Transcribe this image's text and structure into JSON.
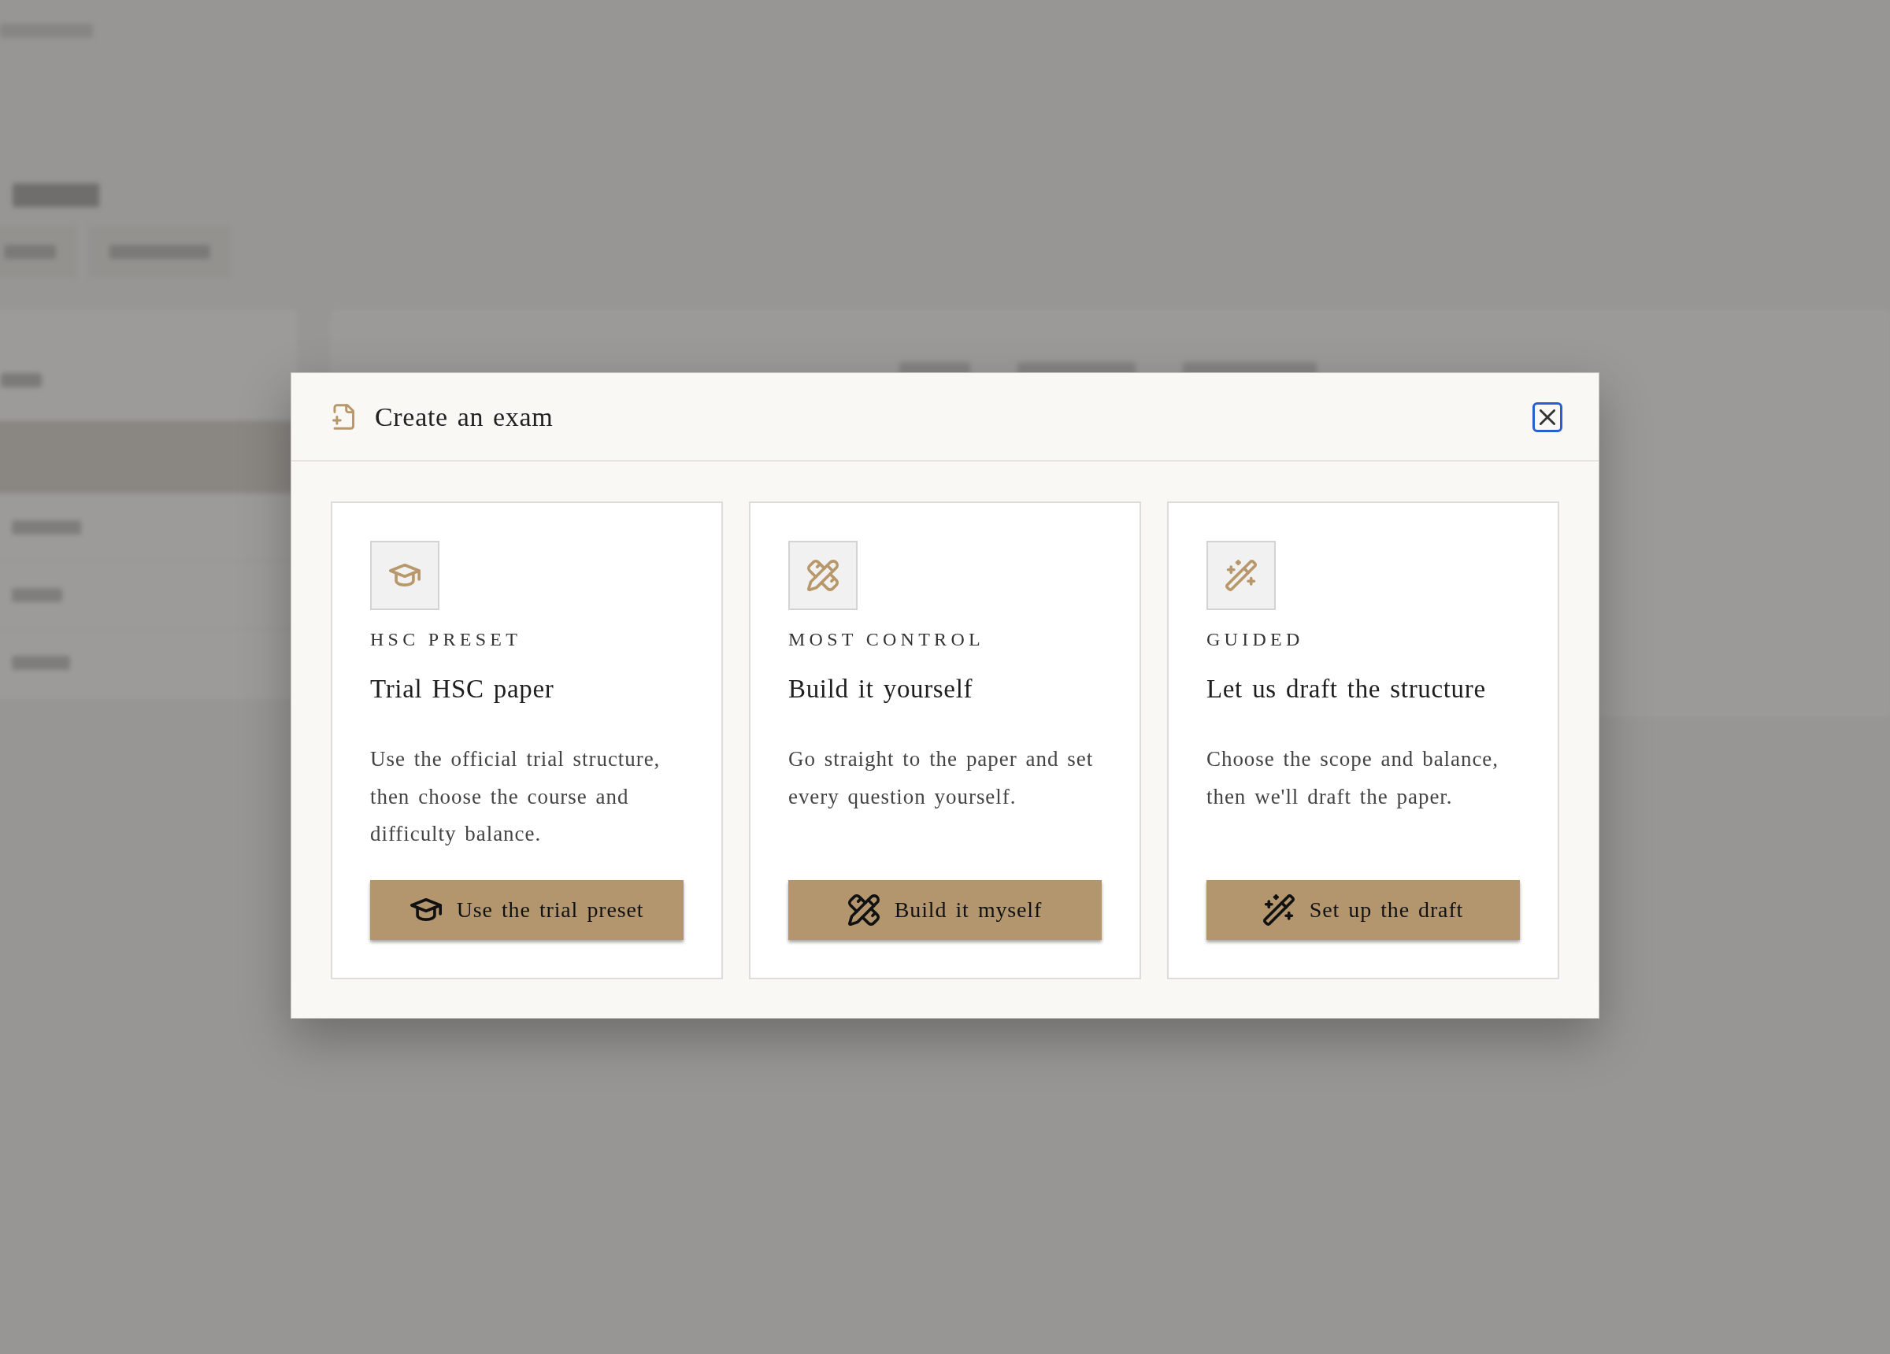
{
  "dialog": {
    "title": "Create an exam",
    "close_button": {
      "focused": true
    },
    "options": [
      {
        "kind": "preset",
        "eyebrow": "HSC PRESET",
        "title": "Trial HSC paper",
        "description": "Use the official trial structure, then choose the course and difficulty balance.",
        "button": "Use the trial preset"
      },
      {
        "kind": "manual",
        "eyebrow": "MOST CONTROL",
        "title": "Build it yourself",
        "description": "Go straight to the paper and set every question yourself.",
        "button": "Build it myself"
      },
      {
        "kind": "guided",
        "eyebrow": "GUIDED",
        "title": "Let us draft the structure",
        "description": "Choose the scope and balance, then we'll draft the paper.",
        "button": "Set up the draft"
      }
    ]
  }
}
